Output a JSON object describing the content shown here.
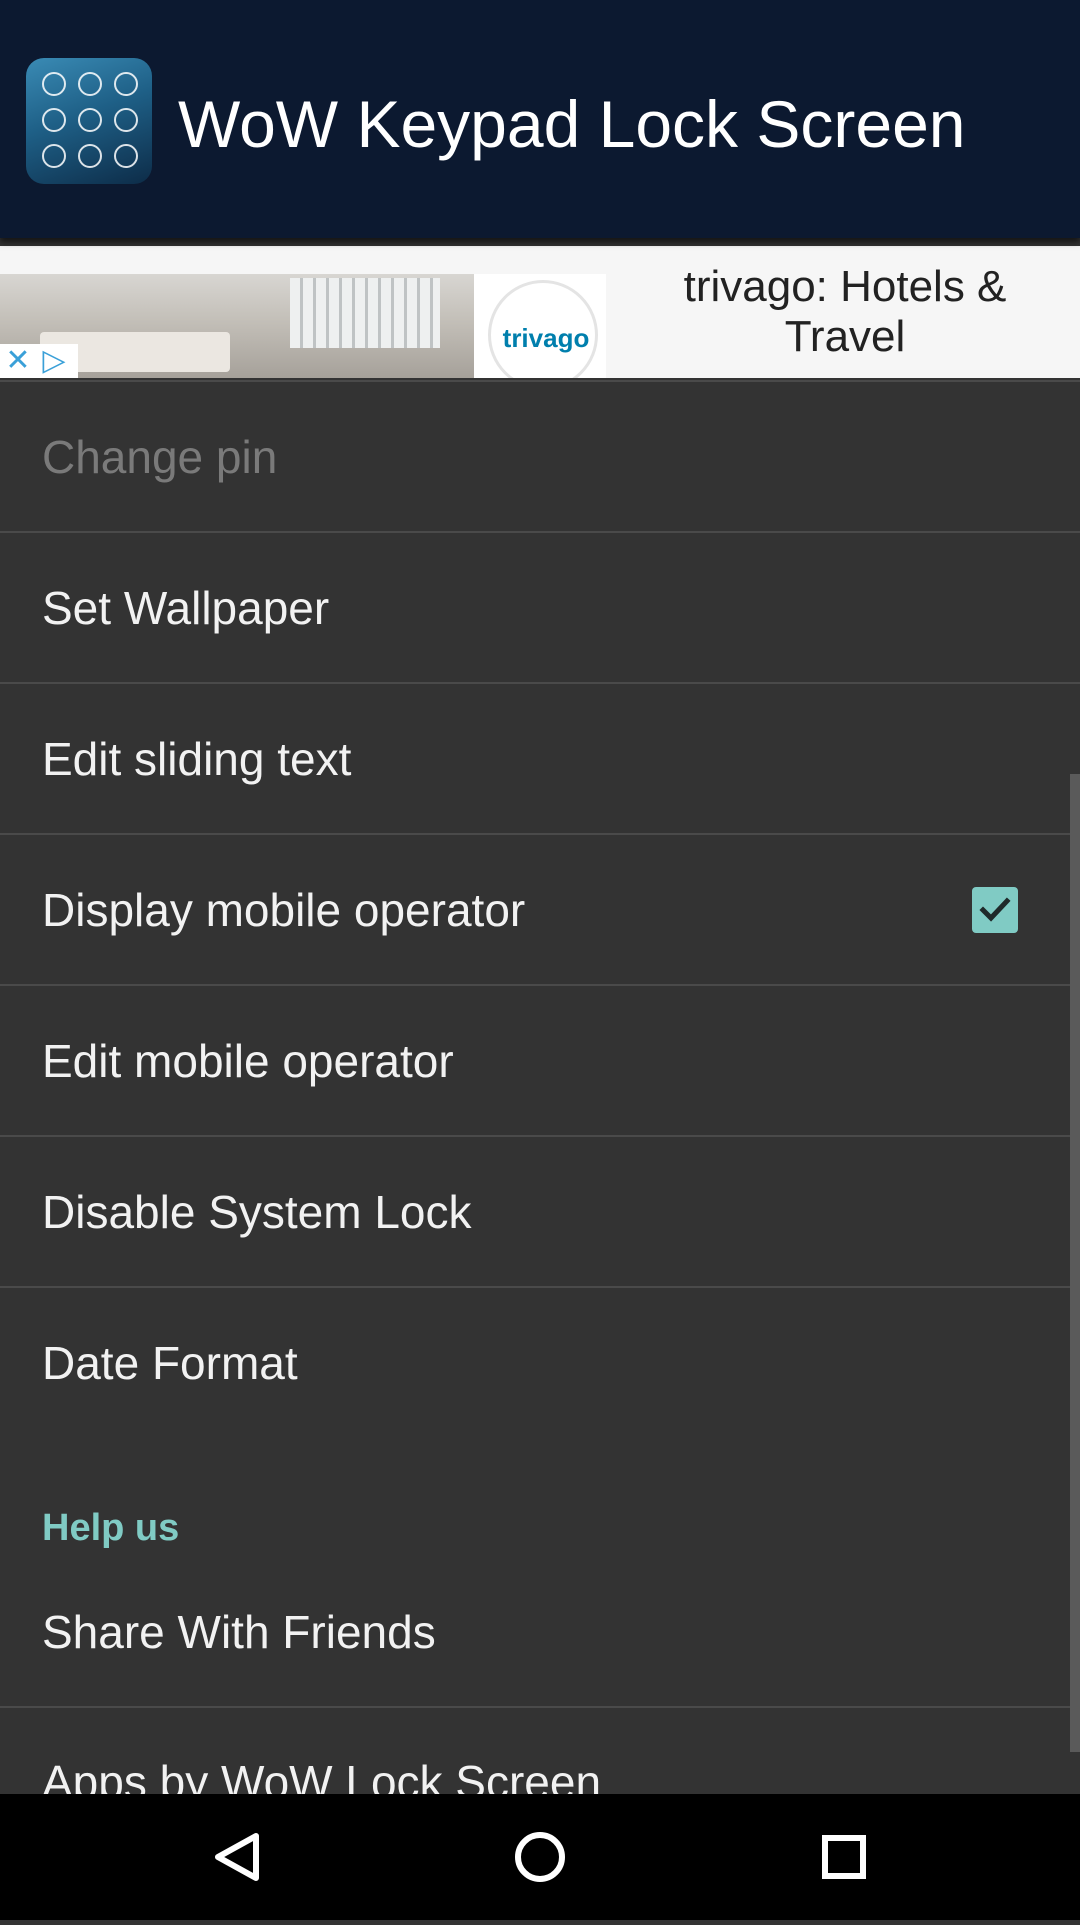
{
  "app_bar": {
    "title": "WoW Keypad Lock Screen"
  },
  "ad": {
    "title": "trivago: Hotels & Travel",
    "brand": "trivago"
  },
  "settings": [
    {
      "label": "Change pin",
      "enabled": false
    },
    {
      "label": "Set Wallpaper",
      "enabled": true
    },
    {
      "label": "Edit sliding text",
      "enabled": true
    },
    {
      "label": "Display mobile operator",
      "enabled": true,
      "checked": true
    },
    {
      "label": "Edit mobile operator",
      "enabled": true
    },
    {
      "label": "Disable System Lock",
      "enabled": true
    },
    {
      "label": "Date Format",
      "enabled": true
    }
  ],
  "help_section": {
    "header": "Help us",
    "items": [
      {
        "label": "Share With Friends"
      },
      {
        "label": "Apps by WoW Lock Screen"
      }
    ]
  },
  "colors": {
    "app_bar_bg": "#0c1930",
    "list_bg": "#333333",
    "accent": "#80cbc4",
    "divider": "#4a4a4a",
    "nav_bg": "#000000"
  },
  "icons": {
    "app_icon": "keypad-app-icon",
    "ad_close": "close-icon",
    "ad_choices": "ad-choices-icon",
    "checkbox": "checkmark-icon",
    "nav_back": "back-triangle-icon",
    "nav_home": "home-circle-icon",
    "nav_recents": "recents-square-icon"
  }
}
